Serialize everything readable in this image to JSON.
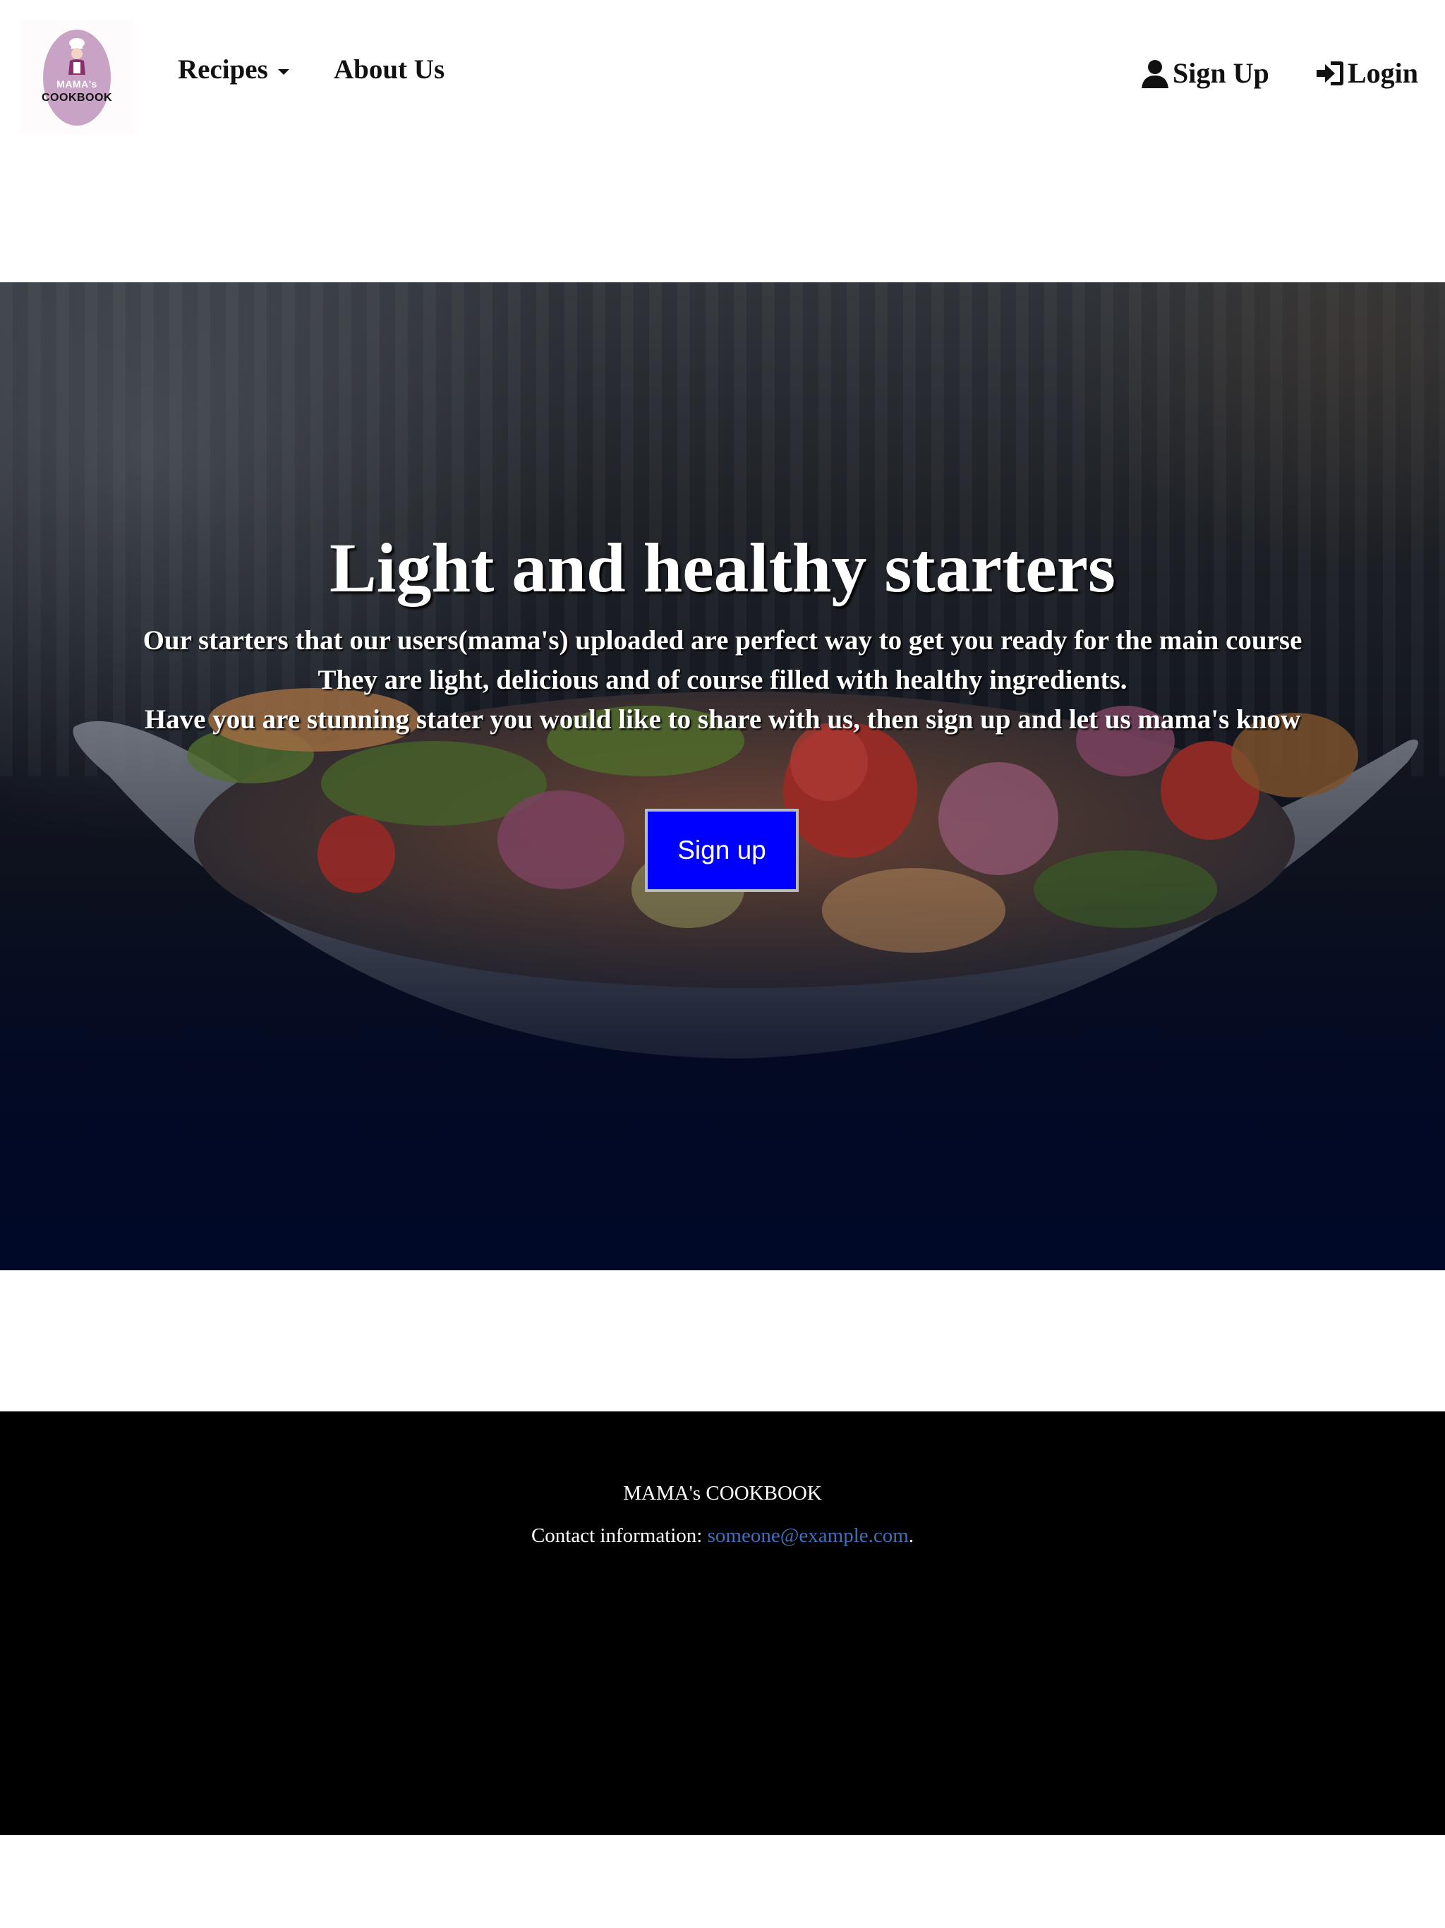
{
  "nav": {
    "logo": {
      "top_text": "MAMA's",
      "bottom_text": "COOKBOOK"
    },
    "recipes_label": "Recipes",
    "about_label": "About Us",
    "signup_label": "Sign Up",
    "login_label": "Login"
  },
  "hero": {
    "title": "Light and healthy starters",
    "lines": [
      "Our starters that our users(mama's) uploaded are perfect way to get you ready for the main course",
      "They are light, delicious and of course filled with healthy ingredients.",
      "Have you are stunning stater you would like to share with us, then sign up and let us mama's know"
    ],
    "cta_label": "Sign up"
  },
  "footer": {
    "brand": "MAMA's COOKBOOK",
    "contact_label": "Contact information:",
    "contact_email": "someone@example.com",
    "contact_suffix": "."
  },
  "colors": {
    "cta_background": "#0000ff",
    "footer_background": "#000000",
    "link": "#3e6fb8",
    "logo_oval": "#c9a3c5"
  },
  "icons": {
    "signup": "user-icon",
    "login": "login-icon",
    "dropdown": "caret-down-icon"
  }
}
